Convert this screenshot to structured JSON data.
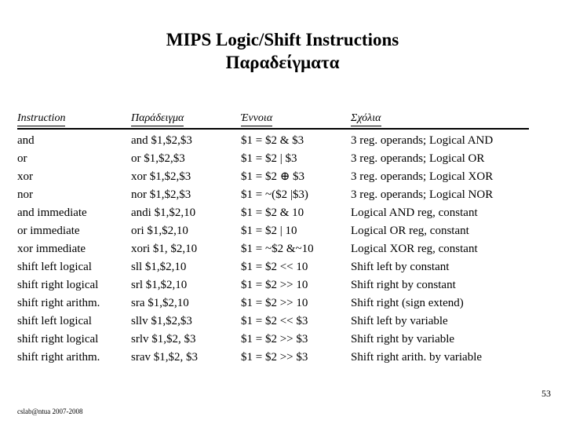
{
  "slide": {
    "title_line1": "MIPS Logic/Shift Instructions",
    "title_line2": "Παραδείγματα",
    "page_number": "53",
    "footer_credit": "cslab@ntua 2007-2008"
  },
  "table": {
    "headers": [
      "Instruction",
      "Παράδειγμα",
      "Έννοια",
      "Σχόλια"
    ],
    "rows": [
      {
        "instruction": "and",
        "example": "and $1,$2,$3",
        "meaning": "$1 = $2 & $3",
        "comment": "3 reg. operands; Logical AND"
      },
      {
        "instruction": "or",
        "example": "or $1,$2,$3",
        "meaning": "$1 = $2 | $3",
        "comment": "3 reg. operands; Logical OR"
      },
      {
        "instruction": "xor",
        "example": "xor $1,$2,$3",
        "meaning": "$1 = $2 ⊕ $3",
        "comment": "3 reg. operands; Logical XOR"
      },
      {
        "instruction": "nor",
        "example": "nor $1,$2,$3",
        "meaning": "$1 = ~($2 |$3)",
        "comment": "3 reg. operands; Logical NOR"
      },
      {
        "instruction": "and immediate",
        "example": "andi $1,$2,10",
        "meaning": "$1 = $2 & 10",
        "comment": "Logical AND reg, constant"
      },
      {
        "instruction": "or immediate",
        "example": "ori $1,$2,10",
        "meaning": "$1 = $2 | 10",
        "comment": "Logical OR reg, constant"
      },
      {
        "instruction": "xor immediate",
        "example": "xori $1, $2,10",
        "meaning": "$1 = ~$2 &~10",
        "comment": "Logical XOR reg, constant"
      },
      {
        "instruction": "shift left logical",
        "example": "sll $1,$2,10",
        "meaning": "$1 = $2 << 10",
        "comment": "Shift left by constant"
      },
      {
        "instruction": "shift right logical",
        "example": "srl $1,$2,10",
        "meaning": "$1 = $2 >> 10",
        "comment": "Shift right by constant"
      },
      {
        "instruction": "shift right arithm.",
        "example": "sra $1,$2,10",
        "meaning": "$1 = $2 >> 10",
        "comment": "Shift right (sign extend)"
      },
      {
        "instruction": "shift left logical",
        "example": "sllv $1,$2,$3",
        "meaning": "$1 = $2 << $3",
        "comment": "Shift left by variable"
      },
      {
        "instruction": "shift right logical",
        "example": "srlv $1,$2, $3",
        "meaning": "$1 = $2 >> $3",
        "comment": "Shift right by variable"
      },
      {
        "instruction": "shift right arithm.",
        "example": "srav $1,$2, $3",
        "meaning": "$1 = $2 >> $3",
        "comment": "Shift right arith. by variable"
      }
    ]
  }
}
